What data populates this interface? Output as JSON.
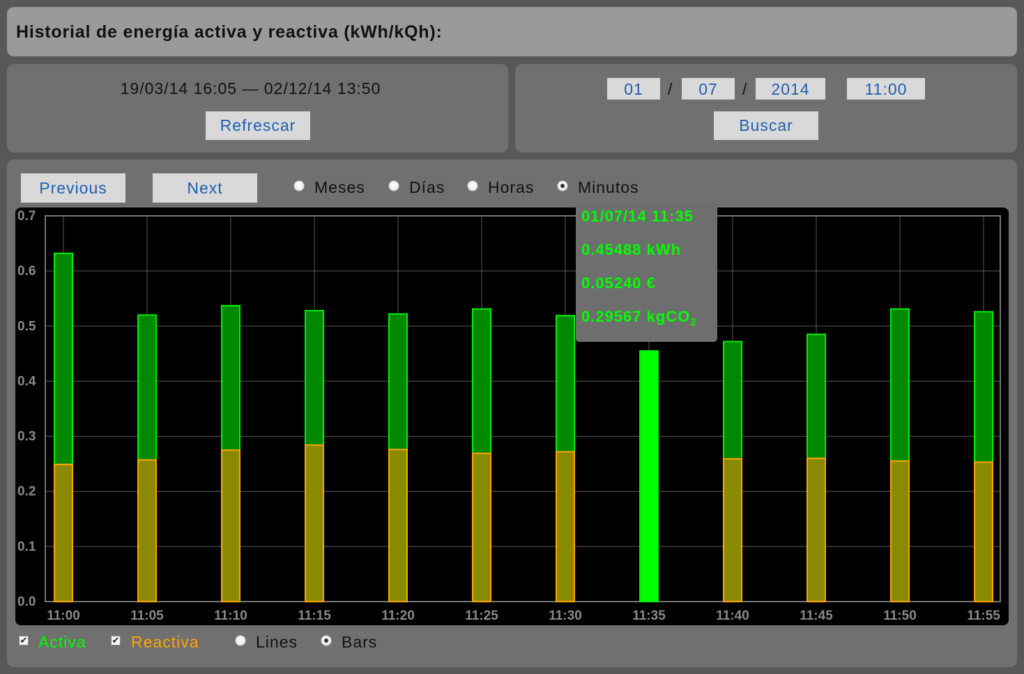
{
  "header": {
    "title": "Historial de energía activa y reactiva (kWh/kQh):"
  },
  "range": {
    "text": "19/03/14 16:05 — 02/12/14 13:50",
    "refresh_label": "Refrescar"
  },
  "search": {
    "day": "01",
    "month": "07",
    "year": "2014",
    "time": "11:00",
    "separator": "/",
    "button_label": "Buscar"
  },
  "nav": {
    "previous_label": "Previous",
    "next_label": "Next"
  },
  "granularity": {
    "options": [
      "Meses",
      "Días",
      "Horas",
      "Minutos"
    ],
    "selected": "Minutos"
  },
  "legend": {
    "activa_label": "Activa",
    "activa_checked": true,
    "activa_color": "#00ff00",
    "reactiva_label": "Reactiva",
    "reactiva_checked": true,
    "reactiva_color": "#ffa500",
    "lines_label": "Lines",
    "bars_label": "Bars",
    "mode_selected": "Bars"
  },
  "tooltip": {
    "datetime": "01/07/14 11:35",
    "kwh": "0.45488 kWh",
    "cost": "0.05240 €",
    "co2_value": "0.29567 kgCO",
    "co2_sub": "2"
  },
  "chart_data": {
    "type": "bar",
    "stacked": false,
    "categories": [
      "11:00",
      "11:05",
      "11:10",
      "11:15",
      "11:20",
      "11:25",
      "11:30",
      "11:35",
      "11:40",
      "11:45",
      "11:50",
      "11:55"
    ],
    "series": [
      {
        "name": "Activa",
        "color": "#00ff00",
        "values": [
          0.632,
          0.52,
          0.537,
          0.528,
          0.522,
          0.531,
          0.519,
          0.455,
          0.472,
          0.485,
          0.531,
          0.526
        ]
      },
      {
        "name": "Reactiva",
        "color": "#ffa500",
        "values": [
          0.249,
          0.257,
          0.275,
          0.284,
          0.276,
          0.269,
          0.272,
          0.0,
          0.259,
          0.26,
          0.255,
          0.253
        ]
      }
    ],
    "highlight_index": 7,
    "ylim": [
      0,
      0.7
    ],
    "yticks": [
      "0.0",
      "0.1",
      "0.2",
      "0.3",
      "0.4",
      "0.5",
      "0.6",
      "0.7"
    ],
    "grid": true,
    "title": "",
    "xlabel": "",
    "ylabel": ""
  }
}
